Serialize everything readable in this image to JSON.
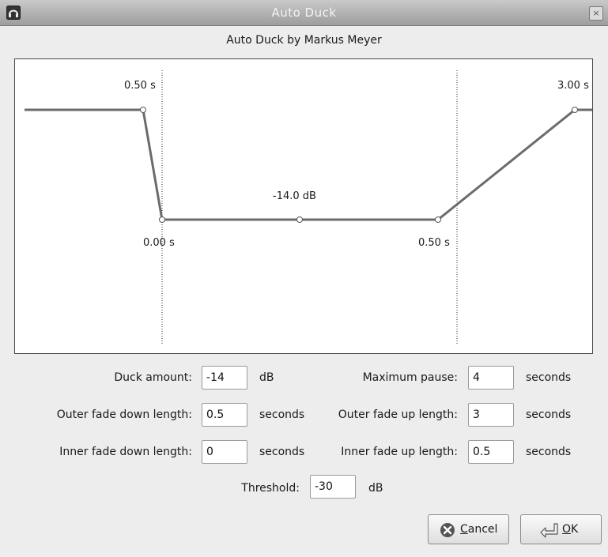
{
  "window": {
    "title": "Auto Duck",
    "close_glyph": "×"
  },
  "header": {
    "subtitle": "Auto Duck by Markus Meyer"
  },
  "graph": {
    "outer_fade_down_label": "0.50 s",
    "inner_fade_down_label": "0.00 s",
    "duck_amount_label": "-14.0 dB",
    "inner_fade_up_label": "0.50 s",
    "outer_fade_up_label": "3.00 s"
  },
  "form": {
    "duck_amount": {
      "label": "Duck amount:",
      "value": "-14",
      "unit": "dB"
    },
    "maximum_pause": {
      "label": "Maximum pause:",
      "value": "4",
      "unit": "seconds"
    },
    "outer_fade_down": {
      "label": "Outer fade down length:",
      "value": "0.5",
      "unit": "seconds"
    },
    "outer_fade_up": {
      "label": "Outer fade up length:",
      "value": "3",
      "unit": "seconds"
    },
    "inner_fade_down": {
      "label": "Inner fade down length:",
      "value": "0",
      "unit": "seconds"
    },
    "inner_fade_up": {
      "label": "Inner fade up length:",
      "value": "0.5",
      "unit": "seconds"
    },
    "threshold": {
      "label": "Threshold:",
      "value": "-30",
      "unit": "dB"
    }
  },
  "buttons": {
    "cancel": {
      "label_first": "C",
      "label_rest": "ancel",
      "icon": "cancel-icon"
    },
    "ok": {
      "label_first": "O",
      "label_rest": "K",
      "icon": "ok-arrow-icon"
    }
  },
  "colors": {
    "curve": "#6b6b6b",
    "cancel_icon": "#555555"
  }
}
